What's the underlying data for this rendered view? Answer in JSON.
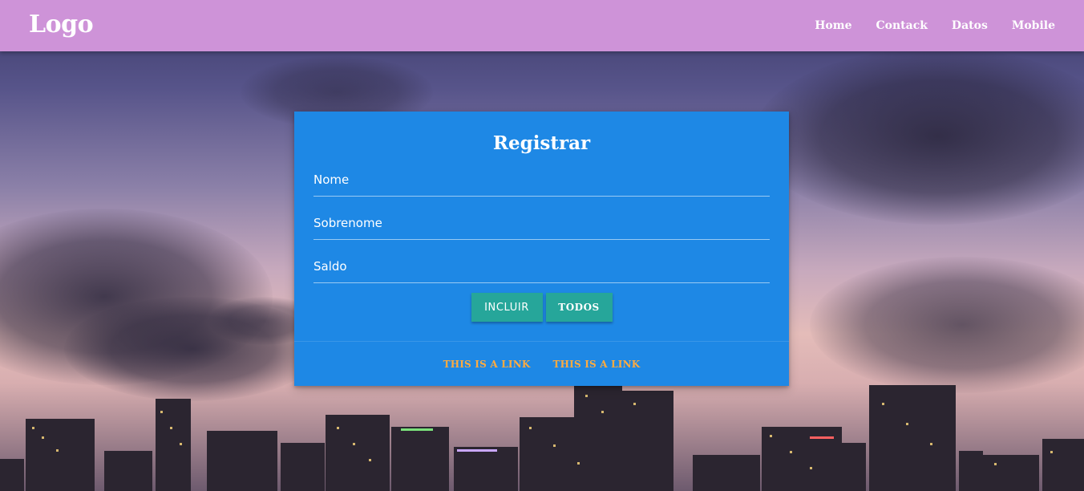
{
  "navbar": {
    "logo": "Logo",
    "links": [
      "Home",
      "Contack",
      "Datos",
      "Mobile"
    ]
  },
  "form": {
    "title": "Registrar",
    "fields": [
      {
        "placeholder": "Nome",
        "value": ""
      },
      {
        "placeholder": "Sobrenome",
        "value": ""
      },
      {
        "placeholder": "Saldo",
        "value": ""
      }
    ],
    "buttons": {
      "incluir": "INCLUIR",
      "todos": "TODOS"
    },
    "links": [
      "THIS IS A LINK",
      "THIS IS A LINK"
    ]
  },
  "colors": {
    "navbar": "#ce93d8",
    "card": "#1e88e5",
    "button": "#26a69a",
    "link": "#ffab40"
  }
}
